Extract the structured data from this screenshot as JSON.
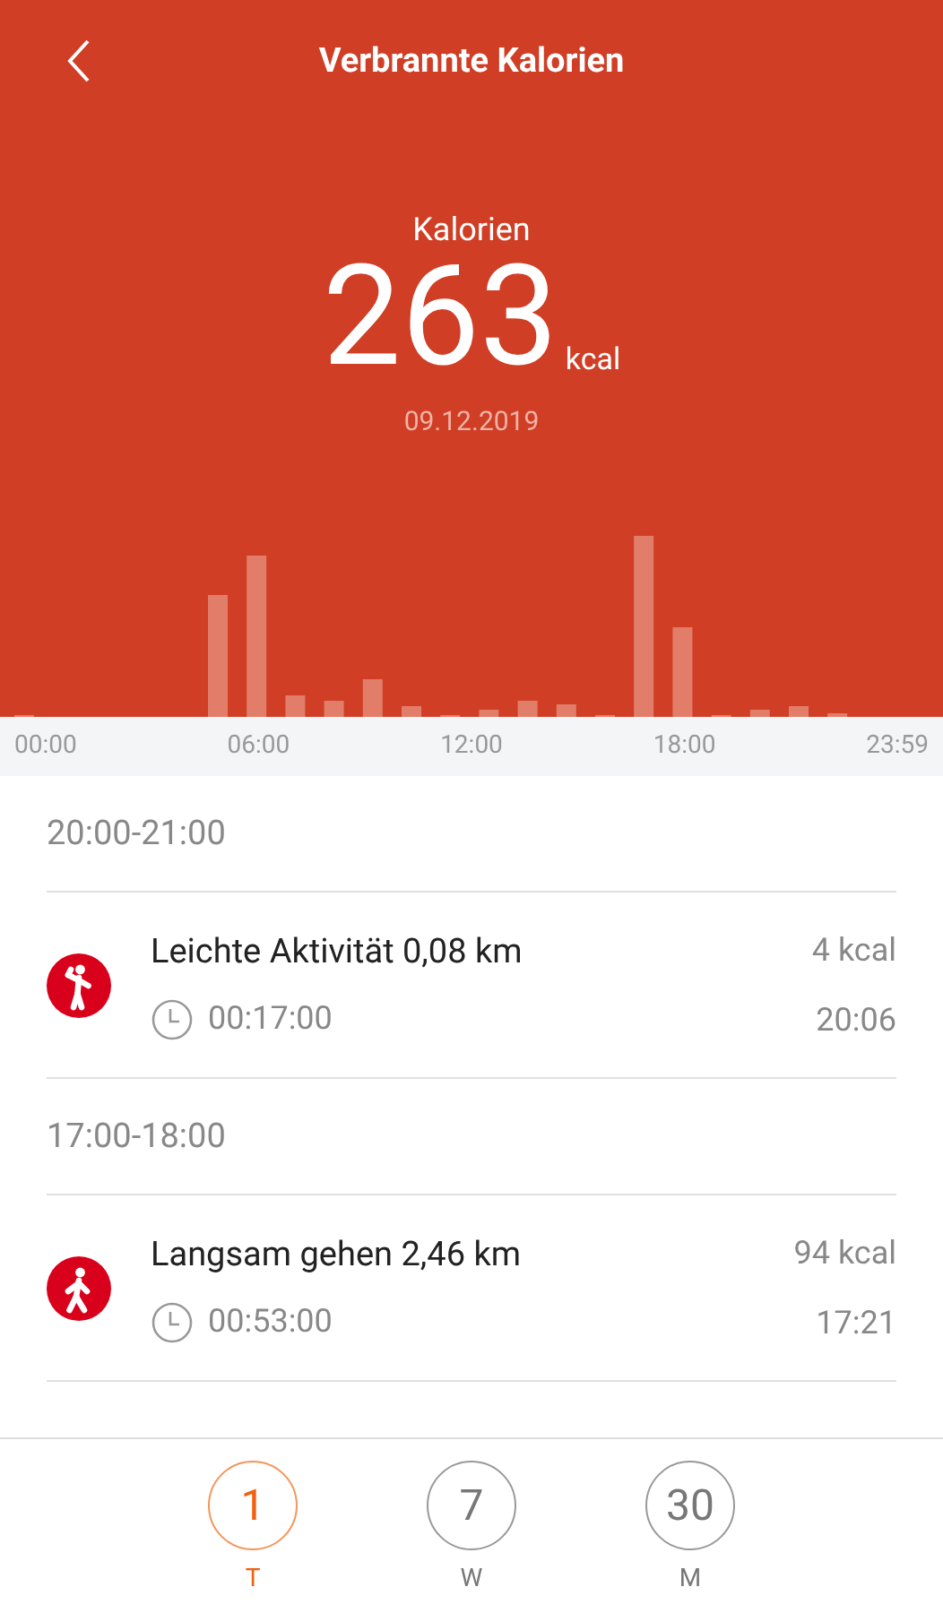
{
  "header": {
    "title": "Verbrannte Kalorien"
  },
  "summary": {
    "label": "Kalorien",
    "value": "263",
    "unit": "kcal",
    "date": "09.12.2019"
  },
  "axis_labels": [
    "00:00",
    "06:00",
    "12:00",
    "18:00",
    "23:59"
  ],
  "sections": [
    {
      "time_range": "20:00-21:00",
      "activities": [
        {
          "kind": "light",
          "title": "Leichte Aktivität 0,08 km",
          "duration": "00:17:00",
          "calories": "4 kcal",
          "time": "20:06"
        }
      ]
    },
    {
      "time_range": "17:00-18:00",
      "activities": [
        {
          "kind": "walk",
          "title": "Langsam gehen 2,46 km",
          "duration": "00:53:00",
          "calories": "94 kcal",
          "time": "17:21"
        }
      ]
    }
  ],
  "periods": [
    {
      "value": "1",
      "label": "T",
      "selected": true
    },
    {
      "value": "7",
      "label": "W",
      "selected": false
    },
    {
      "value": "30",
      "label": "M",
      "selected": false
    }
  ]
}
